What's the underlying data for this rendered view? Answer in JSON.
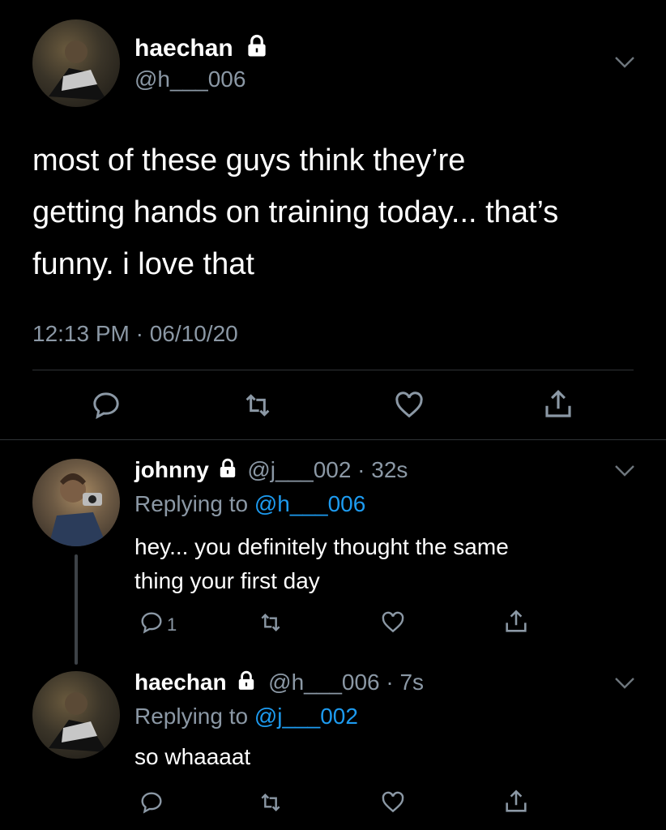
{
  "main_tweet": {
    "author_name": "haechan",
    "handle": "@h___006",
    "text_lines": [
      "most of these guys think they’re",
      "getting hands on training today... that’s",
      "funny. i love that"
    ],
    "timestamp": "12:13 PM · 06/10/20"
  },
  "reply_1": {
    "author_name": "johnny",
    "handle_time": "@j___002 · 32s",
    "replying_prefix": "Replying to ",
    "replying_to": "@h___006",
    "text_lines": [
      "hey... you definitely thought the same",
      "thing your first day"
    ],
    "reply_count": "1"
  },
  "reply_2": {
    "author_name": "haechan",
    "handle_time": "@h___006 · 7s",
    "replying_prefix": "Replying to ",
    "replying_to": "@j___002",
    "text": "so whaaaat"
  },
  "colors": {
    "background": "#000000",
    "text": "#ffffff",
    "muted": "#8b98a5",
    "link": "#1d9bf0",
    "divider": "#2f3336"
  },
  "icons": [
    "lock-icon",
    "chevron-down-icon",
    "reply-icon",
    "retweet-icon",
    "like-icon",
    "share-icon"
  ]
}
